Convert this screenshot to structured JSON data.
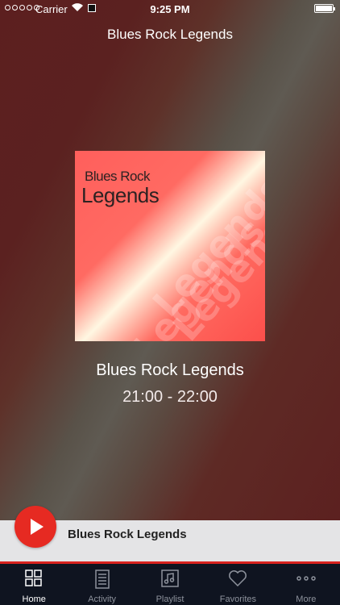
{
  "status": {
    "carrier": "Carrier",
    "time": "9:25 PM"
  },
  "nav": {
    "title": "Blues Rock Legends"
  },
  "artwork": {
    "line1": "Blues Rock",
    "line2": "Legends",
    "watermark": "Legends"
  },
  "now_playing": {
    "show": "Blues Rock Legends",
    "time": "21:00 - 22:00"
  },
  "mini_player": {
    "title": "Blues Rock Legends"
  },
  "tabs": [
    {
      "label": "Home",
      "icon": "grid-icon",
      "active": true
    },
    {
      "label": "Activity",
      "icon": "document-icon",
      "active": false
    },
    {
      "label": "Playlist",
      "icon": "music-note-icon",
      "active": false
    },
    {
      "label": "Favorites",
      "icon": "heart-icon",
      "active": false
    },
    {
      "label": "More",
      "icon": "more-icon",
      "active": false
    }
  ],
  "colors": {
    "accent": "#e62a22",
    "tab_bar": "#0f1420",
    "mini_player": "#e4e4e6"
  }
}
